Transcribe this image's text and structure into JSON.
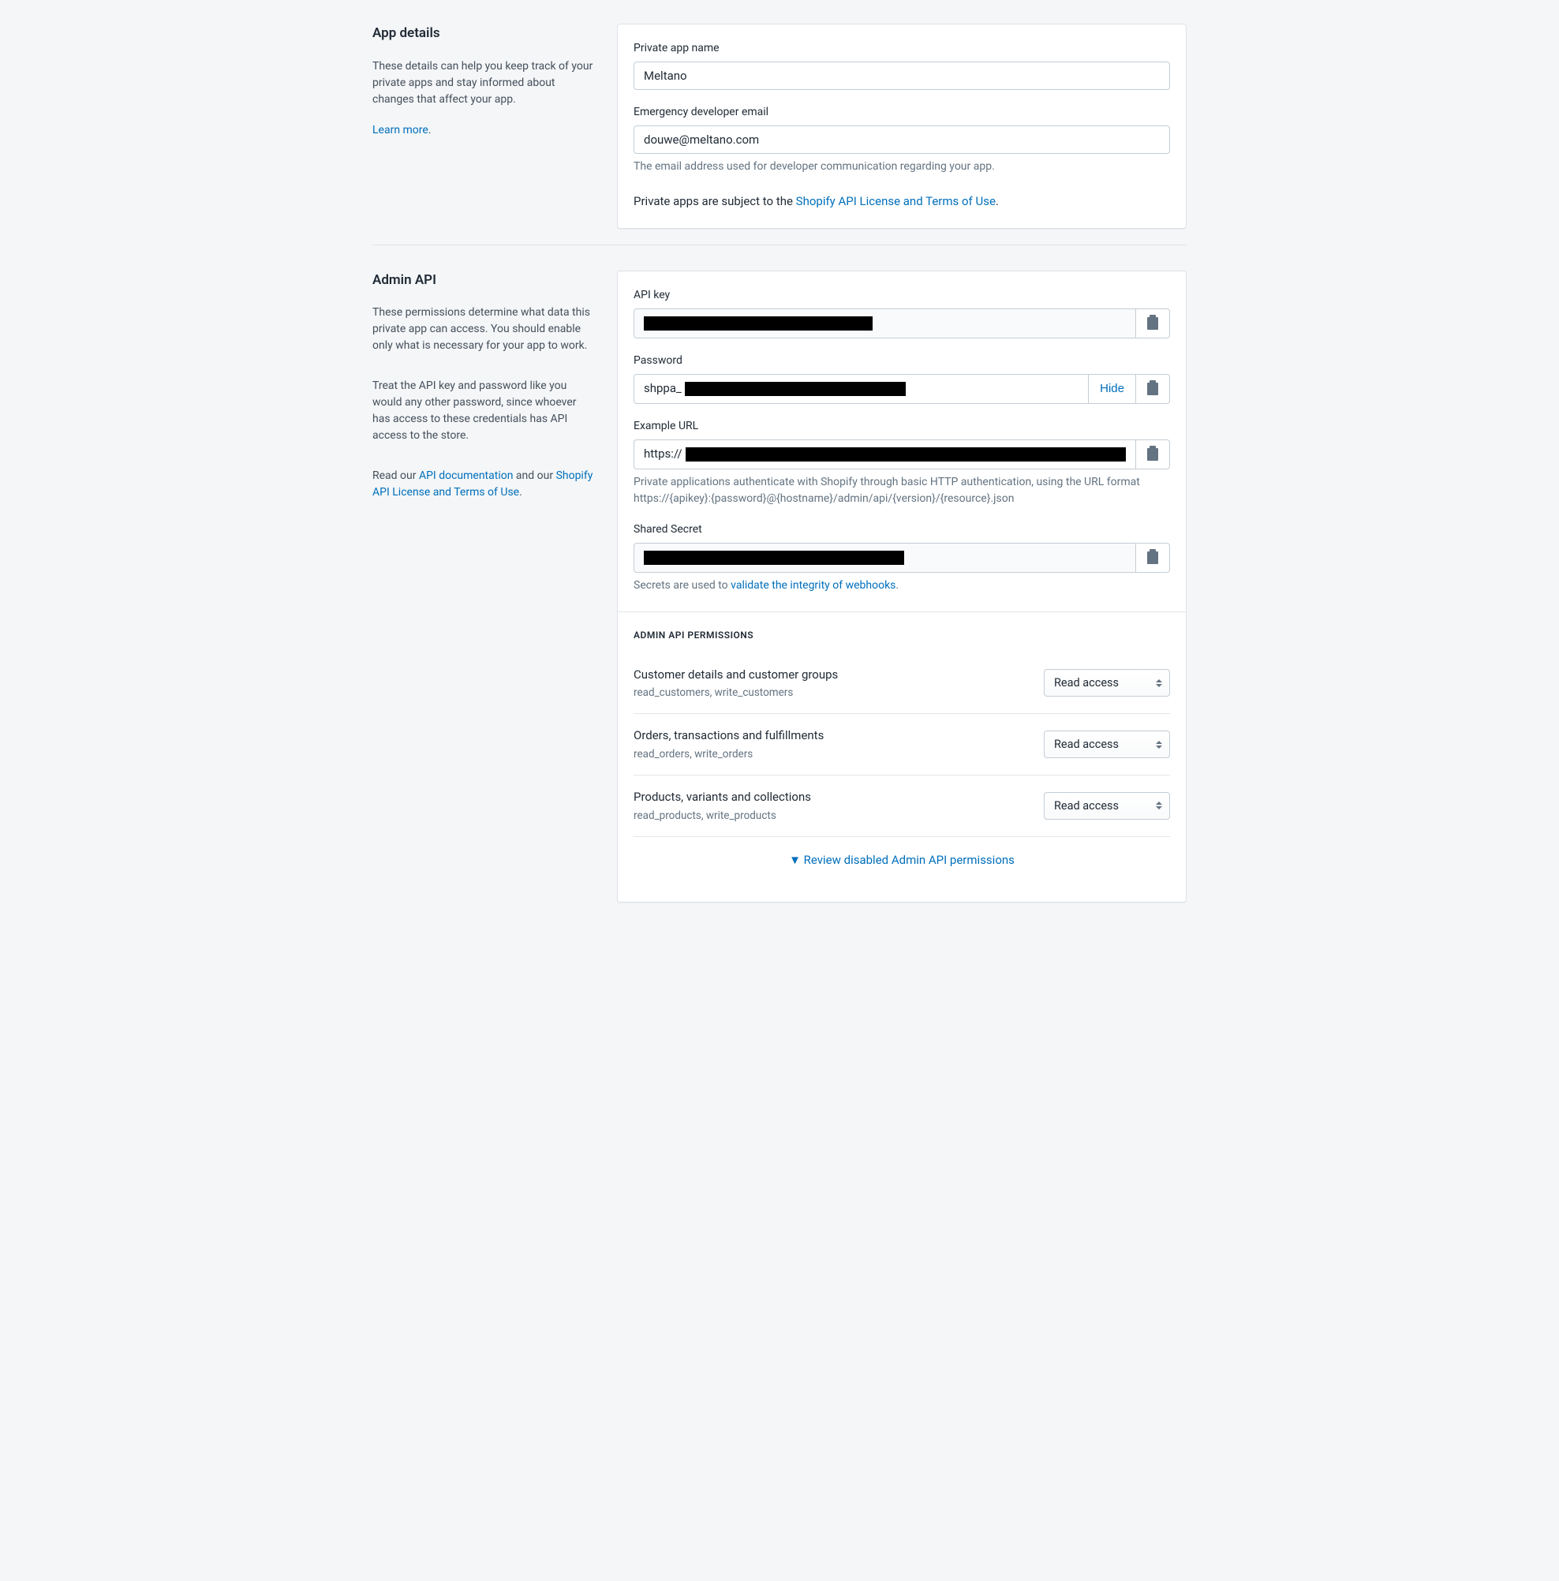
{
  "app_details": {
    "heading": "App details",
    "desc": "These details can help you keep track of your private apps and stay informed about changes that affect your app.",
    "learn_more": "Learn more",
    "period": ".",
    "name_label": "Private app name",
    "name_value": "Meltano",
    "email_label": "Emergency developer email",
    "email_value": "douwe@meltano.com",
    "email_help": "The email address used for developer communication regarding your app.",
    "license_prefix": "Private apps are subject to the ",
    "license_link": "Shopify API License and Terms of Use",
    "license_suffix": "."
  },
  "admin_api": {
    "heading": "Admin API",
    "desc1": "These permissions determine what data this private app can access. You should enable only what is necessary for your app to work.",
    "desc2": "Treat the API key and password like you would any other password, since whoever has access to these credentials has API access to the store.",
    "desc3_prefix": "Read our ",
    "api_doc_link": "API documentation",
    "desc3_mid": " and our ",
    "license_link": "Shopify API License and Terms of Use",
    "desc3_suffix": ".",
    "api_key_label": "API key",
    "password_label": "Password",
    "password_prefix": "shppa_",
    "hide": "Hide",
    "example_url_label": "Example URL",
    "example_url_prefix": "https://",
    "example_url_help": "Private applications authenticate with Shopify through basic HTTP authentication, using the URL format https://{apikey}:{password}@{hostname}/admin/api/{version}/{resource}.json",
    "shared_secret_label": "Shared Secret",
    "shared_secret_help_prefix": "Secrets are used to ",
    "shared_secret_help_link": "validate the integrity of webhooks",
    "shared_secret_help_suffix": ".",
    "perm_heading": "ADMIN API PERMISSIONS",
    "permissions": [
      {
        "title": "Customer details and customer groups",
        "scopes": "read_customers, write_customers",
        "selected": "Read access"
      },
      {
        "title": "Orders, transactions and fulfillments",
        "scopes": "read_orders, write_orders",
        "selected": "Read access"
      },
      {
        "title": "Products, variants and collections",
        "scopes": "read_products, write_products",
        "selected": "Read access"
      }
    ],
    "review_disabled_glyph": "▼",
    "review_disabled": " Review disabled Admin API permissions"
  }
}
